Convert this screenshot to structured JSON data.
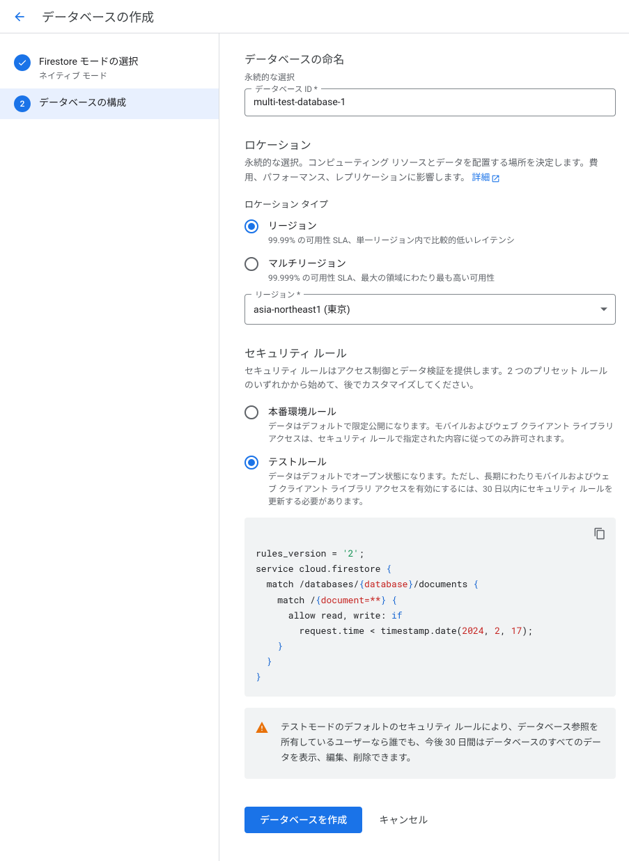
{
  "header": {
    "title": "データベースの作成"
  },
  "steps": [
    {
      "title": "Firestore モードの選択",
      "sub": "ネイティブ モード",
      "done": true
    },
    {
      "num": "2",
      "title": "データベースの構成",
      "active": true
    }
  ],
  "naming": {
    "title": "データベースの命名",
    "sub": "永続的な選択",
    "field_label": "データベース ID *",
    "value": "multi-test-database-1"
  },
  "location": {
    "title": "ロケーション",
    "desc_a": "永続的な選択。コンピューティング リソースとデータを配置する場所を決定します。費用、パフォーマンス、レプリケーションに影響します。",
    "link": "詳細",
    "type_label": "ロケーション タイプ",
    "options": [
      {
        "label": "リージョン",
        "desc": "99.99% の可用性 SLA、単一リージョン内で比較的低いレイテンシ",
        "checked": true
      },
      {
        "label": "マルチリージョン",
        "desc": "99.999% の可用性 SLA、最大の領域にわたり最も高い可用性",
        "checked": false
      }
    ],
    "region_label": "リージョン *",
    "region_value": "asia-northeast1 (東京)"
  },
  "security": {
    "title": "セキュリティ ルール",
    "desc": "セキュリティ ルールはアクセス制御とデータ検証を提供します。2 つのプリセット ルールのいずれかから始めて、後でカスタマイズしてください。",
    "options": [
      {
        "label": "本番環境ルール",
        "desc": "データはデフォルトで限定公開になります。モバイルおよびウェブ クライアント ライブラリ アクセスは、セキュリティ ルールで指定された内容に従ってのみ許可されます。",
        "checked": false
      },
      {
        "label": "テストルール",
        "desc": "データはデフォルトでオープン状態になります。ただし、長期にわたりモバイルおよびウェブ クライアント ライブラリ アクセスを有効にするには、30 日以内にセキュリティ ルールを更新する必要があります。",
        "checked": true
      }
    ],
    "code": {
      "rules_version": "'2'",
      "date_y": "2024",
      "date_m": "2",
      "date_d": "17"
    },
    "warning": "テストモードのデフォルトのセキュリティ ルールにより、データベース参照を所有しているユーザーなら誰でも、今後 30 日間はデータベースのすべてのデータを表示、編集、削除できます。"
  },
  "actions": {
    "create": "データベースを作成",
    "cancel": "キャンセル"
  }
}
